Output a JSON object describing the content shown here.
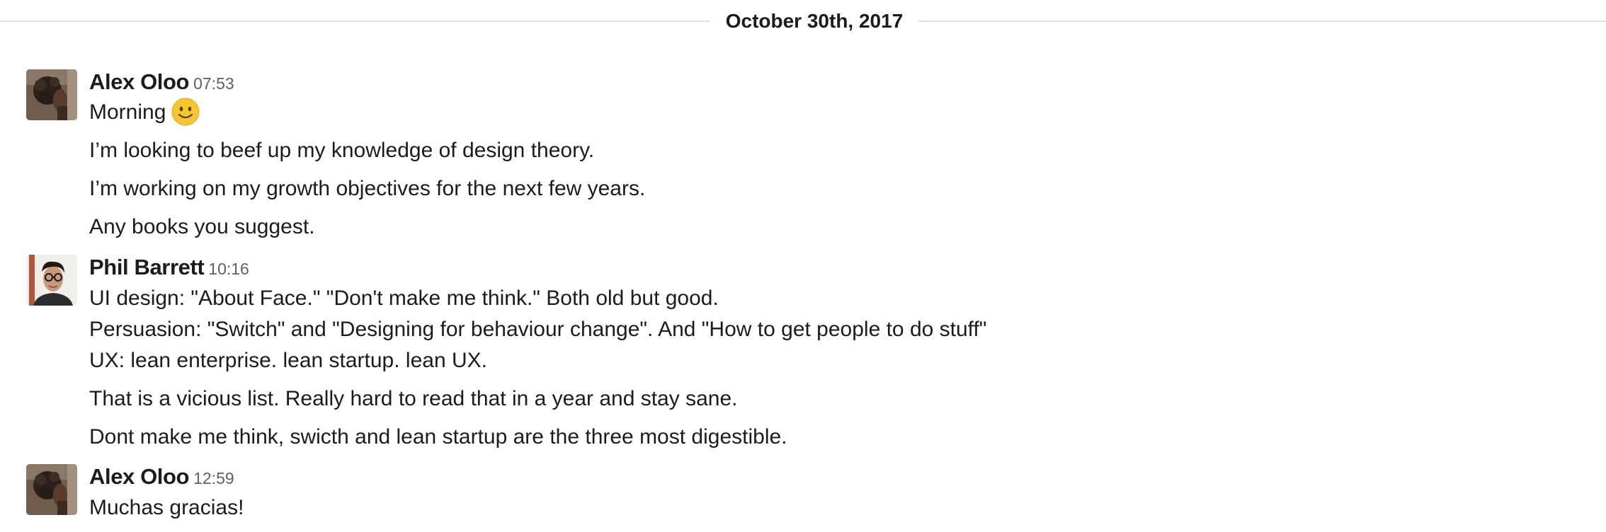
{
  "divider": {
    "date": "October 30th, 2017"
  },
  "messages": [
    {
      "author": "Alex Oloo",
      "time": "07:53",
      "first_line": "Morning",
      "emoji": "slightly-smiling-face",
      "lines": [
        "I’m looking to beef up my knowledge of design theory.",
        "I’m working on my growth objectives for the next few years.",
        "Any books you suggest."
      ]
    },
    {
      "author": "Phil Barrett",
      "time": "10:16",
      "lines": [
        "UI design: \"About Face.\"  \"Don't make me think.\"  Both old but good.",
        "Persuasion: \"Switch\" and \"Designing for behaviour change\". And \"How to get people to do stuff\"",
        "UX:  lean enterprise. lean startup. lean UX.",
        "That is a vicious list.  Really hard to read that in a year and stay sane.",
        "Dont make me think, swicth and lean startup are the three most digestible."
      ]
    },
    {
      "author": "Alex Oloo",
      "time": "12:59",
      "lines": [
        "Muchas gracias!"
      ]
    }
  ]
}
